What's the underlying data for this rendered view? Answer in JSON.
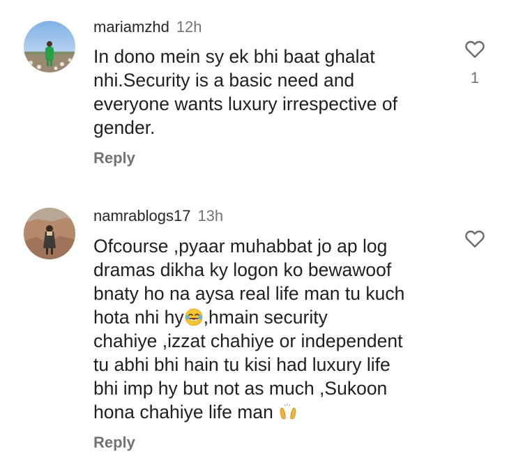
{
  "comments": [
    {
      "username": "mariamzhd",
      "time": "12h",
      "text": "In dono mein sy ek bhi baat ghalat\nnhi.Security is a basic need and\neveryone wants luxury irrespective of\ngender.",
      "reply_label": "Reply",
      "like_count": "1",
      "avatar": "avatar-woman-in-field",
      "like_icon": "heart-outline-icon"
    },
    {
      "username": "namrablogs17",
      "time": "13h",
      "text_before_emoji1": "Ofcourse ,pyaar muhabbat jo ap log\ndramas dikha ky logon ko bewawoof\nbnaty ho na aysa real life man tu kuch\nhota nhi hy",
      "emoji1": "face-with-tears-of-joy",
      "text_after_emoji1": ",hmain security\nchahiye ,izzat chahiye or independent\ntu abhi bhi hain tu kisi had luxury life\nbhi imp hy but not as much ,Sukoon\nhona chahiye life man ",
      "emoji2": "raising-hands",
      "reply_label": "Reply",
      "avatar": "avatar-woman-on-rocks",
      "like_icon": "heart-outline-icon"
    }
  ],
  "colors": {
    "primary_text": "#262626",
    "secondary_text": "#737373",
    "background": "#ffffff"
  }
}
